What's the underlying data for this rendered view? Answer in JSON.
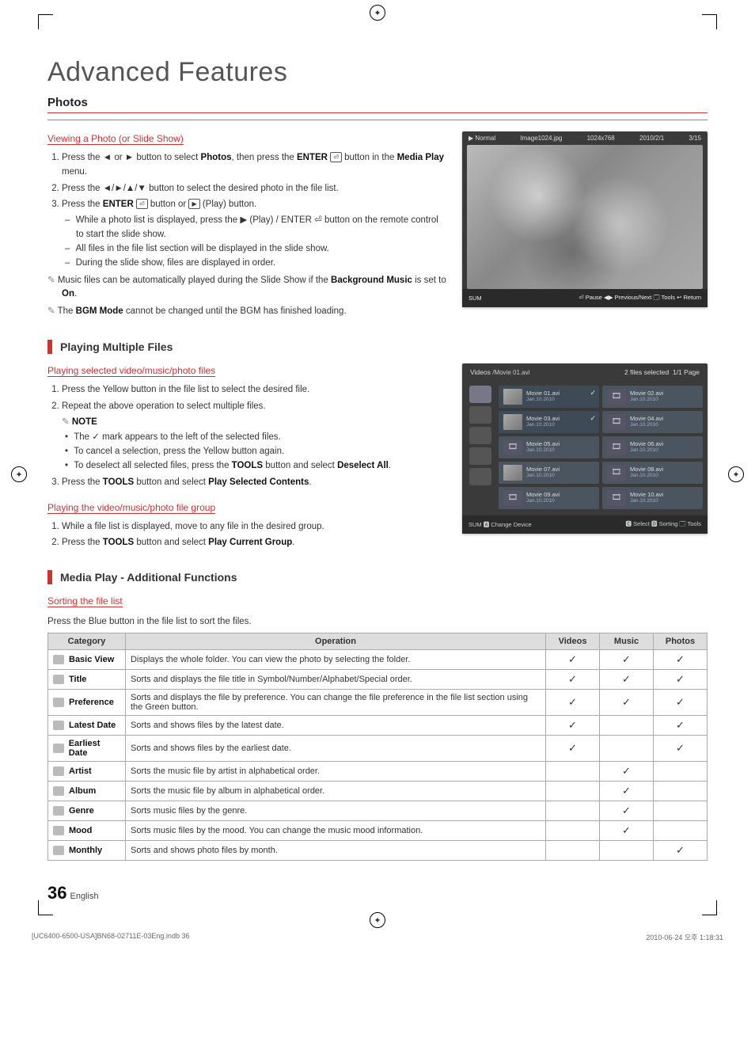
{
  "page_title": "Advanced Features",
  "section_photos": "Photos",
  "viewing_heading": "Viewing a Photo (or Slide Show)",
  "steps_view": [
    "Press the ◄ or ► button to select Photos, then press the ENTER ⏎ button in the Media Play menu.",
    "Press the ◄/►/▲/▼ button to select the desired photo in the file list.",
    "Press the ENTER ⏎ button or ▶ (Play) button."
  ],
  "view_sub": [
    "While a photo list is displayed, press the ▶ (Play) / ENTER ⏎ button on the remote control to start the slide show.",
    "All files in the file list section will be displayed in the slide show.",
    "During the slide show, files are displayed in order."
  ],
  "note_music": "Music files can be automatically played during the Slide Show if the Background Music is set to On.",
  "note_bgm": "The BGM Mode cannot be changed until the BGM has finished loading.",
  "playing_multi_title": "Playing Multiple Files",
  "playing_selected_heading": "Playing selected video/music/photo files",
  "pm_step1": "Press the Yellow button in the file list to select the desired file.",
  "pm_step2": "Repeat the above operation to select multiple files.",
  "pm_note_label": "NOTE",
  "pm_notes": [
    "The ✓ mark appears to the left of the selected files.",
    "To cancel a selection, press the Yellow button again.",
    "To deselect all selected files, press the TOOLS button and select Deselect All."
  ],
  "pm_step3": "Press the TOOLS button and select Play Selected Contents.",
  "playing_group_heading": "Playing the video/music/photo file group",
  "pg_step1": "While a file list is displayed, move to any file in the desired group.",
  "pg_step2": "Press the TOOLS button and select Play Current Group.",
  "media_add_title": "Media Play - Additional Functions",
  "sorting_heading": "Sorting the file list",
  "sorting_intro": "Press the Blue button in the file list to sort the files.",
  "table": {
    "headers": [
      "Category",
      "Operation",
      "Videos",
      "Music",
      "Photos"
    ],
    "rows": [
      {
        "cat": "Basic View",
        "op": "Displays the whole folder. You can view the photo by selecting the folder.",
        "v": "✓",
        "m": "✓",
        "p": "✓"
      },
      {
        "cat": "Title",
        "op": "Sorts and displays the file title in Symbol/Number/Alphabet/Special order.",
        "v": "✓",
        "m": "✓",
        "p": "✓"
      },
      {
        "cat": "Preference",
        "op": "Sorts and displays the file by preference. You can change the file preference in the file list section using the Green button.",
        "v": "✓",
        "m": "✓",
        "p": "✓"
      },
      {
        "cat": "Latest Date",
        "op": "Sorts and shows files by the latest date.",
        "v": "✓",
        "m": "",
        "p": "✓"
      },
      {
        "cat": "Earliest Date",
        "op": "Sorts and shows files by the earliest date.",
        "v": "✓",
        "m": "",
        "p": "✓"
      },
      {
        "cat": "Artist",
        "op": "Sorts the music file by artist in alphabetical order.",
        "v": "",
        "m": "✓",
        "p": ""
      },
      {
        "cat": "Album",
        "op": "Sorts the music file by album in alphabetical order.",
        "v": "",
        "m": "✓",
        "p": ""
      },
      {
        "cat": "Genre",
        "op": "Sorts music files by the genre.",
        "v": "",
        "m": "✓",
        "p": ""
      },
      {
        "cat": "Mood",
        "op": "Sorts music files by the mood. You can change the music mood information.",
        "v": "",
        "m": "✓",
        "p": ""
      },
      {
        "cat": "Monthly",
        "op": "Sorts and shows photo files by month.",
        "v": "",
        "m": "",
        "p": "✓"
      }
    ]
  },
  "shot1": {
    "mode": "▶ Normal",
    "file": "Image1024.jpg",
    "res": "1024x768",
    "date": "2010/2/1",
    "pos": "3/15",
    "sum": "SUM",
    "controls": "⏎ Pause  ◀▶ Previous/Next  🗔 Tools  ↩ Return"
  },
  "shot2": {
    "tab": "Videos",
    "bc": "/Movie 01.avi",
    "sel": "2 files selected",
    "page": "1/1 Page",
    "tiles": [
      {
        "n": "Movie 01.avi",
        "d": "Jan.10.2010",
        "sel": true,
        "thumb": true
      },
      {
        "n": "Movie 02.avi",
        "d": "Jan.10.2010",
        "sel": false,
        "thumb": false
      },
      {
        "n": "Movie 03.avi",
        "d": "Jan.10.2010",
        "sel": true,
        "thumb": true
      },
      {
        "n": "Movie 04.avi",
        "d": "Jan.10.2010",
        "sel": false,
        "thumb": false
      },
      {
        "n": "Movie 05.avi",
        "d": "Jan.10.2010",
        "sel": false,
        "thumb": false
      },
      {
        "n": "Movie 06.avi",
        "d": "Jan.10.2010",
        "sel": false,
        "thumb": false
      },
      {
        "n": "Movie 07.avi",
        "d": "Jan.10.2010",
        "sel": false,
        "thumb": true
      },
      {
        "n": "Movie 08.avi",
        "d": "Jan.10.2010",
        "sel": false,
        "thumb": false
      },
      {
        "n": "Movie 09.avi",
        "d": "Jan.10.2010",
        "sel": false,
        "thumb": false
      },
      {
        "n": "Movie 10.avi",
        "d": "Jan.10.2010",
        "sel": false,
        "thumb": false
      }
    ],
    "ftr_left": "SUM  🅰 Change Device",
    "ftr_right": "🅲 Select  🅳 Sorting  🗔 Tools"
  },
  "page_number": "36",
  "page_lang": "English",
  "footer_left": "[UC6400-6500-USA]BN68-02711E-03Eng.indb   36",
  "footer_right": "2010-06-24   오후 1:18:31"
}
